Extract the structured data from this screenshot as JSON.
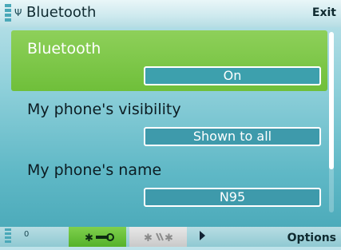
{
  "header": {
    "title": "Bluetooth",
    "exit_label": "Exit"
  },
  "settings": [
    {
      "label": "Bluetooth",
      "value": "On",
      "highlighted": true
    },
    {
      "label": "My phone's visibility",
      "value": "Shown to all",
      "highlighted": false
    },
    {
      "label": "My phone's name",
      "value": "N95",
      "highlighted": false
    }
  ],
  "footer": {
    "options_label": "Options",
    "mode_indicator": "0"
  },
  "tabs": [
    {
      "icon": "bluetooth-settings-icon",
      "active": true
    },
    {
      "icon": "paired-devices-icon",
      "active": false
    }
  ],
  "colors": {
    "highlight": "#6fbf3a",
    "value_box": "#3e9aab"
  }
}
